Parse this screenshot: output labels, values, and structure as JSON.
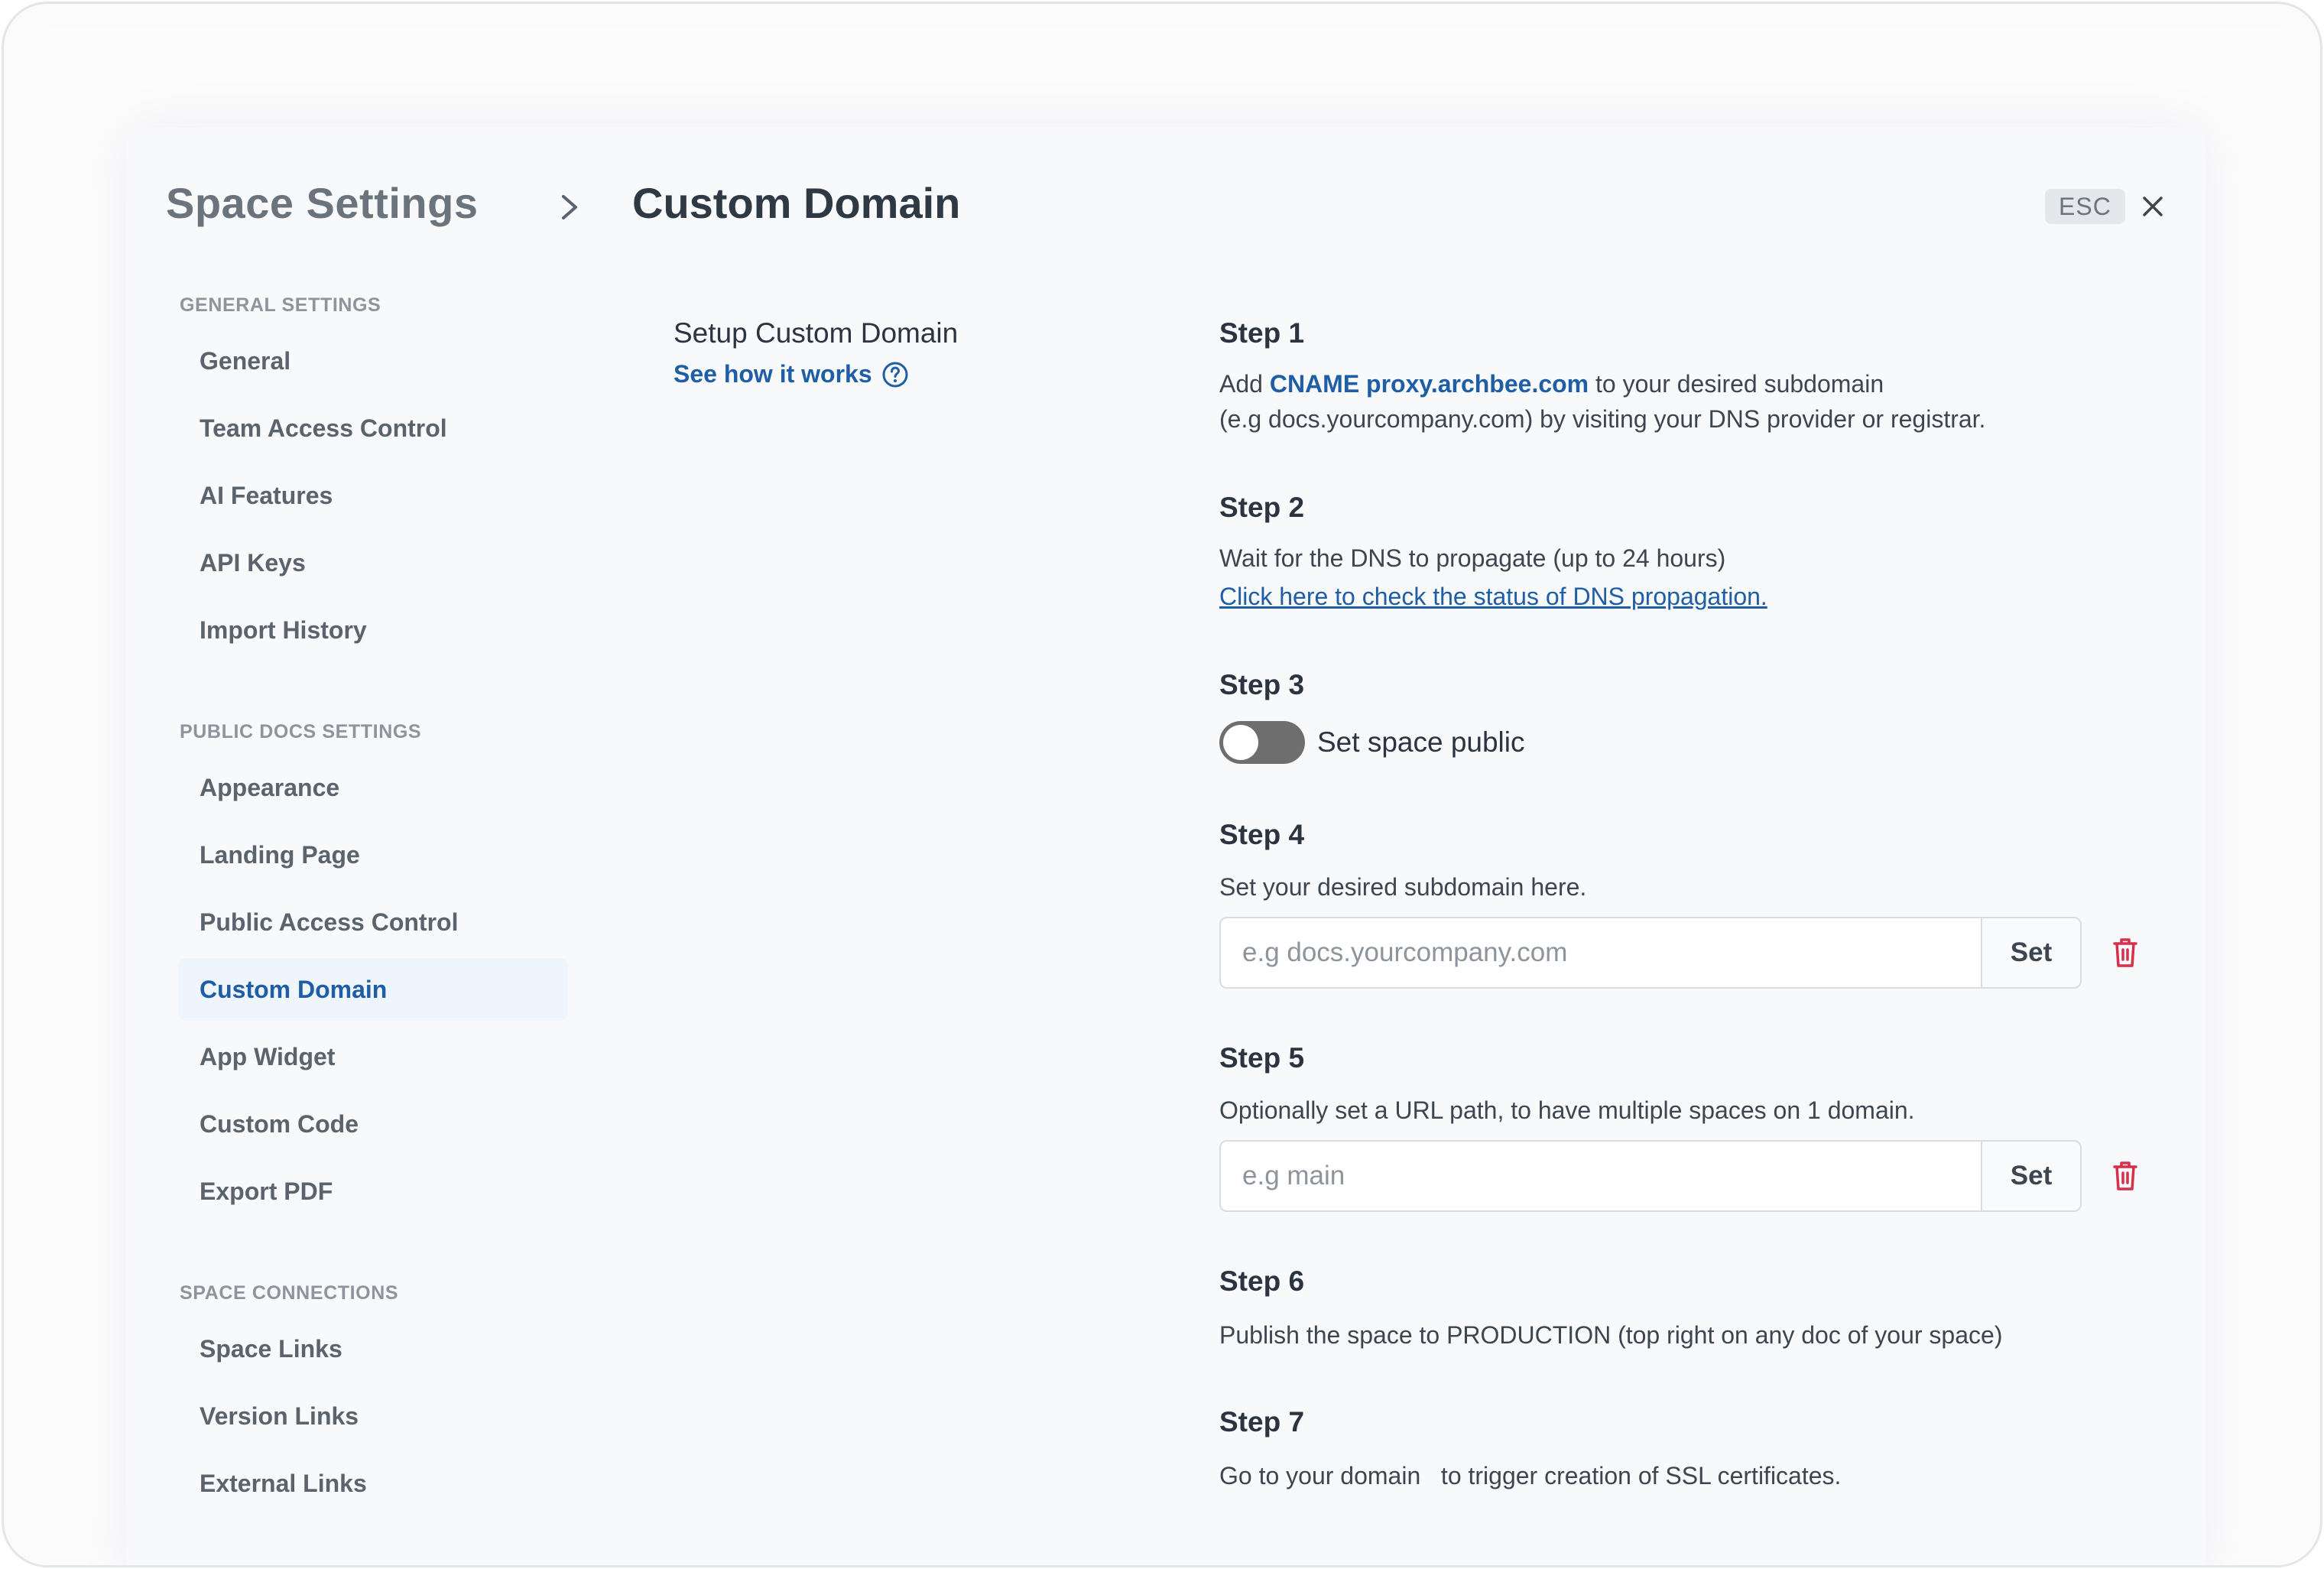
{
  "header": {
    "section_title": "Space Settings",
    "page_title": "Custom Domain",
    "esc_label": "ESC"
  },
  "sidebar": {
    "groups": [
      {
        "heading": "GENERAL SETTINGS",
        "items": [
          {
            "label": "General"
          },
          {
            "label": "Team Access Control"
          },
          {
            "label": "AI Features"
          },
          {
            "label": "API Keys"
          },
          {
            "label": "Import History"
          }
        ]
      },
      {
        "heading": "PUBLIC DOCS SETTINGS",
        "items": [
          {
            "label": "Appearance"
          },
          {
            "label": "Landing Page"
          },
          {
            "label": "Public Access Control"
          },
          {
            "label": "Custom Domain",
            "active": true
          },
          {
            "label": "App Widget"
          },
          {
            "label": "Custom Code"
          },
          {
            "label": "Export PDF"
          }
        ]
      },
      {
        "heading": "SPACE CONNECTIONS",
        "items": [
          {
            "label": "Space Links"
          },
          {
            "label": "Version Links"
          },
          {
            "label": "External Links"
          }
        ]
      }
    ]
  },
  "setup": {
    "title": "Setup Custom Domain",
    "link": "See how it works"
  },
  "steps": {
    "s1": {
      "title": "Step 1",
      "text_a": "Add ",
      "cname": "CNAME proxy.archbee.com",
      "text_b": " to your desired subdomain",
      "text_c": "(e.g docs.yourcompany.com) by visiting your DNS provider or registrar."
    },
    "s2": {
      "title": "Step 2",
      "text": "Wait for the DNS to propagate (up to 24 hours)",
      "link": "Click here to check the status of DNS propagation."
    },
    "s3": {
      "title": "Step 3",
      "toggle_label": "Set space public",
      "toggle_on": false
    },
    "s4": {
      "title": "Step 4",
      "text": "Set your desired subdomain here.",
      "placeholder": "e.g docs.yourcompany.com",
      "value": "",
      "button": "Set"
    },
    "s5": {
      "title": "Step 5",
      "text": "Optionally set a URL path, to have multiple spaces on 1 domain.",
      "placeholder": "e.g main",
      "value": "",
      "button": "Set"
    },
    "s6": {
      "title": "Step 6",
      "text": "Publish the space to PRODUCTION (top right on any doc of your space)"
    },
    "s7": {
      "title": "Step 7",
      "text": "Go to your domain   to trigger creation of SSL certificates."
    }
  },
  "colors": {
    "accent": "#1f5ea5",
    "danger": "#d6304a",
    "active_bg": "#eef5fc",
    "toggle_off": "#6e6e6e"
  },
  "icons": {
    "chevron": "chevron-right-icon",
    "close": "close-icon",
    "help": "question-circle-icon",
    "delete": "trash-icon"
  }
}
